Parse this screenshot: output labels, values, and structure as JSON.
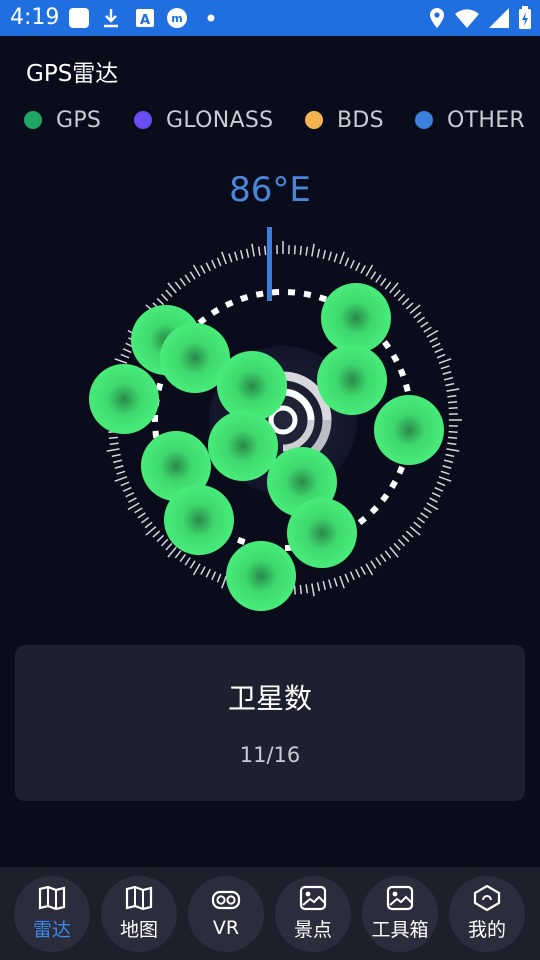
{
  "status_bar": {
    "time": "4:19",
    "icons": [
      "square-icon",
      "download-icon",
      "a-badge-icon",
      "m-badge-icon",
      "dot-icon",
      "location-icon",
      "wifi-icon",
      "signal-icon",
      "battery-icon"
    ]
  },
  "page": {
    "title": "GPS雷达"
  },
  "legend": [
    {
      "label": "GPS",
      "color": "#1fa565"
    },
    {
      "label": "GLONASS",
      "color": "#6a4cf0"
    },
    {
      "label": "BDS",
      "color": "#f4b550"
    },
    {
      "label": "OTHER",
      "color": "#3b7fdc"
    }
  ],
  "compass": {
    "heading": "86°E"
  },
  "satellite_color": "#3ee070",
  "card": {
    "title": "卫星数",
    "value": "11/16"
  },
  "nav": [
    {
      "label": "雷达",
      "icon": "radar-map-icon",
      "active": true
    },
    {
      "label": "地图",
      "icon": "map-icon",
      "active": false
    },
    {
      "label": "VR",
      "icon": "vr-glasses-icon",
      "active": false
    },
    {
      "label": "景点",
      "icon": "scenic-photo-icon",
      "active": false
    },
    {
      "label": "工具箱",
      "icon": "toolbox-icon",
      "active": false
    },
    {
      "label": "我的",
      "icon": "profile-icon",
      "active": false
    }
  ]
}
